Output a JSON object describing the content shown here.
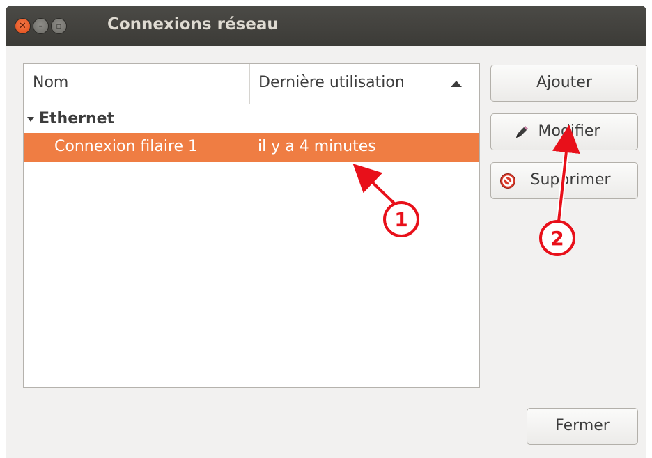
{
  "window": {
    "title": "Connexions réseau",
    "controls": [
      "close-icon",
      "minimize-icon",
      "maximize-icon"
    ]
  },
  "list": {
    "columns": [
      "Nom",
      "Dernière utilisation"
    ],
    "sort": "descending-indicator",
    "groups": [
      {
        "label": "Ethernet",
        "rows": [
          {
            "name": "Connexion filaire 1",
            "last_used": "il y a 4 minutes",
            "selected": true
          }
        ]
      }
    ]
  },
  "buttons": {
    "add": "Ajouter",
    "edit": "Modifier",
    "delete": "Supprimer",
    "close": "Fermer"
  },
  "annotations": [
    "1",
    "2"
  ],
  "colors": {
    "selection": "#ef7d43",
    "titlebar": "#3c3b37",
    "annotation": "#e8101a"
  }
}
